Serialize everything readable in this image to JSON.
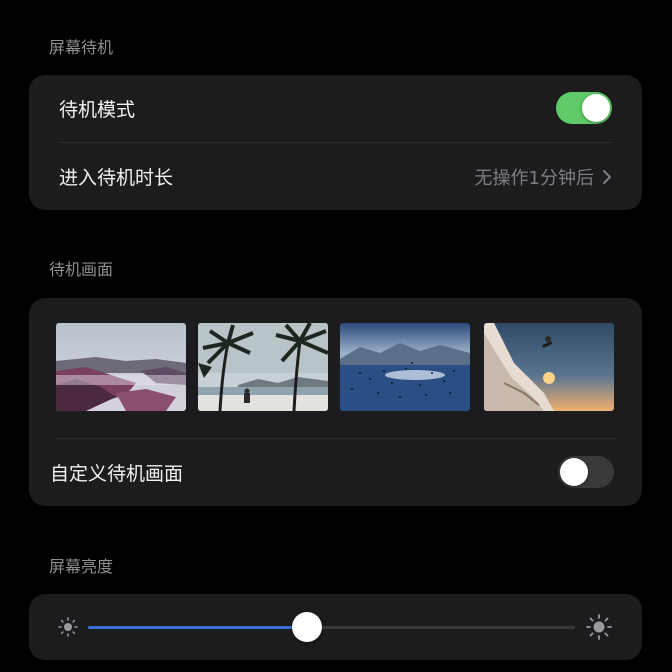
{
  "standby": {
    "section_title": "屏幕待机",
    "mode_label": "待机模式",
    "mode_enabled": true,
    "duration_label": "进入待机时长",
    "duration_value": "无操作1分钟后"
  },
  "standby_screen": {
    "section_title": "待机画面",
    "wallpapers": [
      {
        "name": "rocky-coast-mist"
      },
      {
        "name": "palm-beach"
      },
      {
        "name": "lake-with-birds"
      },
      {
        "name": "snowboarder-jump"
      }
    ],
    "custom_label": "自定义待机画面",
    "custom_enabled": false
  },
  "brightness": {
    "section_title": "屏幕亮度",
    "level": 0.45,
    "low_icon": "sun-small-icon",
    "high_icon": "sun-large-icon"
  },
  "colors": {
    "accent": "#3a6fd8",
    "toggle_on": "#5fca67"
  }
}
